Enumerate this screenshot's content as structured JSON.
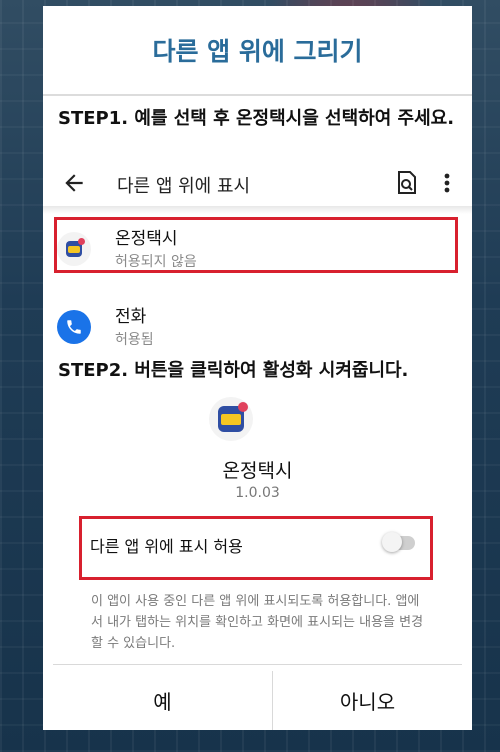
{
  "dialog": {
    "title": "다른 앱 위에 그리기",
    "step1": "STEP1. 예를 선택 후 온정택시을 선택하여 주세요.",
    "step2": "STEP2. 버튼을 클릭하여 활성화 시켜줍니다."
  },
  "settings_screen": {
    "title": "다른 앱 위에 표시",
    "icons": [
      "back-arrow-icon",
      "search-document-icon",
      "more-vertical-icon"
    ],
    "apps": [
      {
        "name": "온정택시",
        "status": "허용되지 않음",
        "icon": "taxi-app-icon"
      },
      {
        "name": "전화",
        "status": "허용됨",
        "icon": "phone-icon"
      }
    ]
  },
  "app_detail": {
    "name": "온정택시",
    "version": "1.0.03",
    "toggle_label": "다른 앱 위에 표시 허용",
    "toggle_on": false,
    "description": "이 앱이 사용 중인 다른 앱 위에 표시되도록 허용합니다. 앱에서 내가 탭하는 위치를 확인하고 화면에 표시되는 내용을 변경할 수 있습니다."
  },
  "buttons": {
    "yes": "예",
    "no": "아니오"
  },
  "colors": {
    "title": "#2a6c9a",
    "highlight": "#d8202e",
    "phone": "#1a73e8"
  }
}
